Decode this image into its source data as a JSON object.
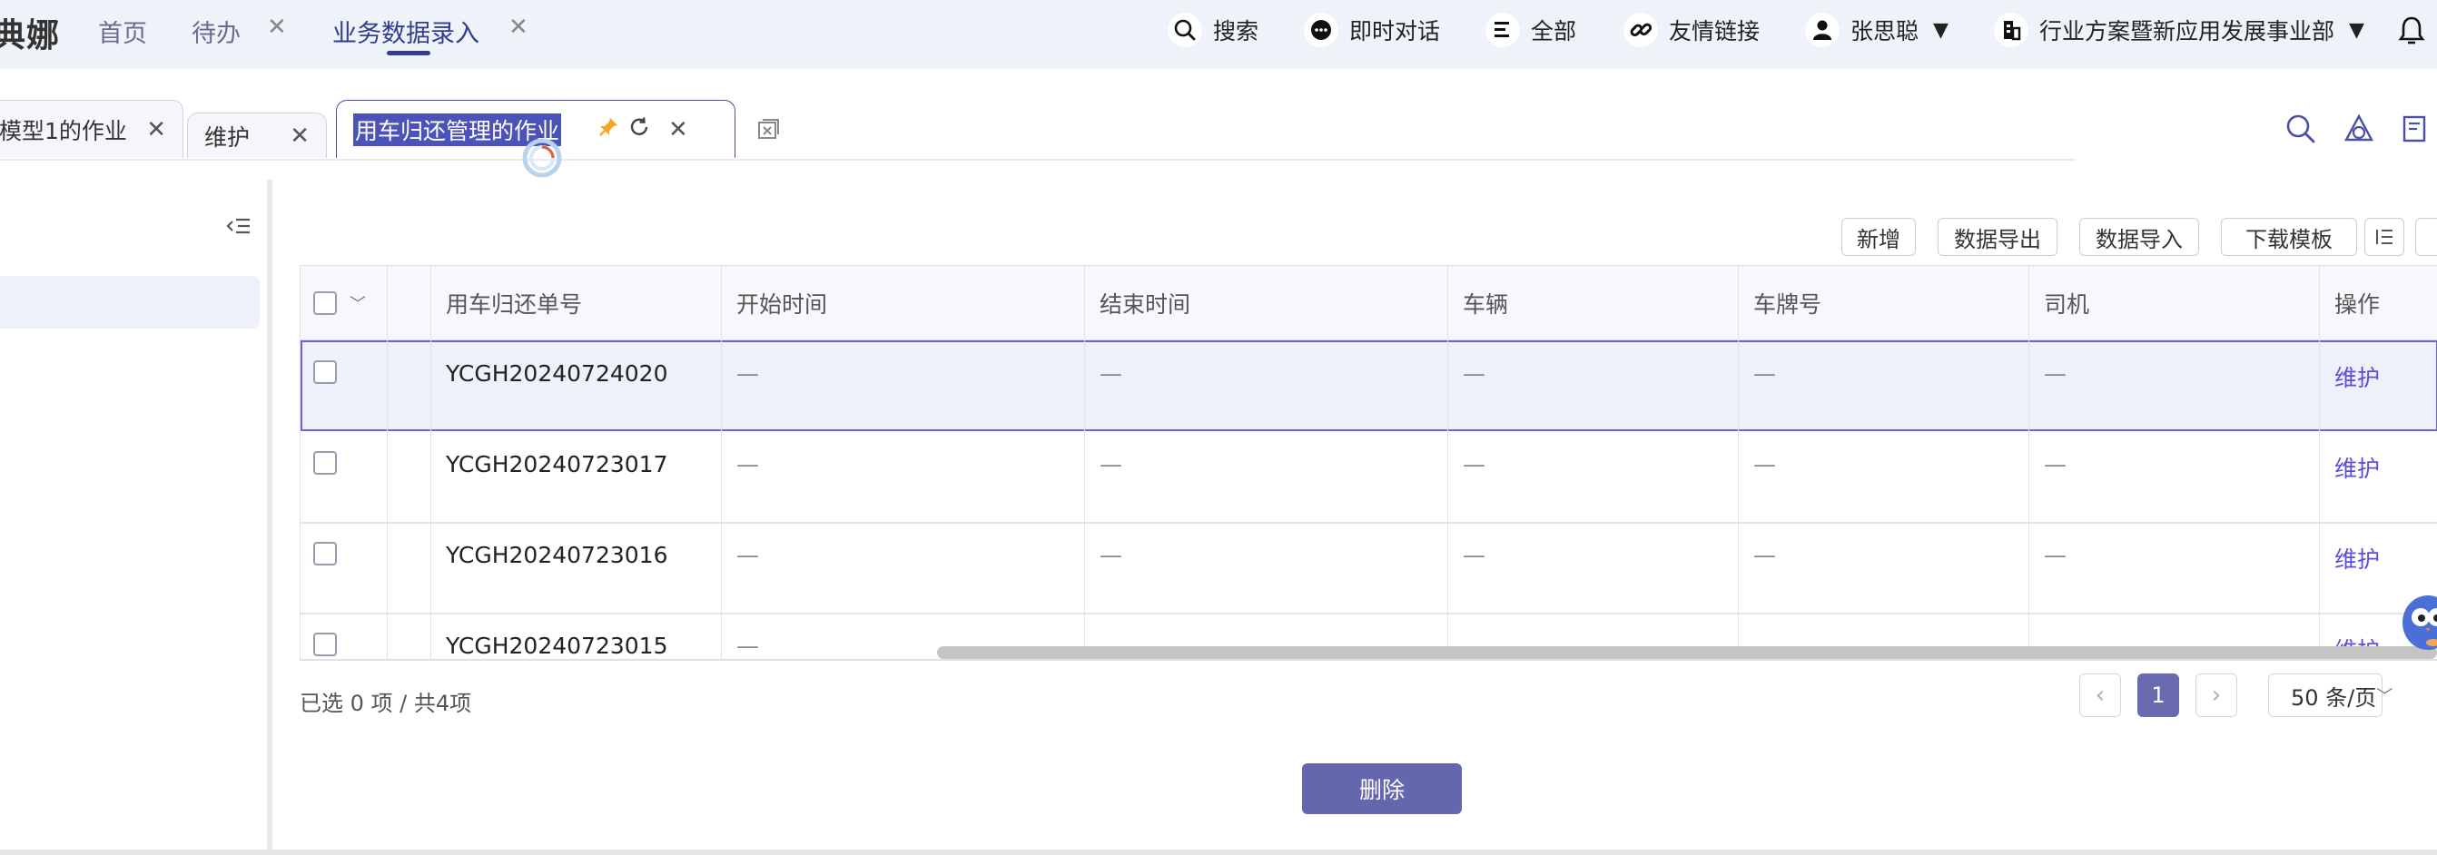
{
  "topbar": {
    "brand": "典娜",
    "nav": [
      {
        "label": "首页"
      },
      {
        "label": "待办"
      },
      {
        "label": "业务数据录入"
      }
    ],
    "tools": {
      "search": "搜索",
      "chat": "即时对话",
      "all": "全部",
      "links": "友情链接",
      "user": "张思聪",
      "org": "行业方案暨新应用发展事业部"
    }
  },
  "tabs": [
    {
      "label": "模型1的作业"
    },
    {
      "label": "维护"
    },
    {
      "label": "用车归还管理的作业"
    }
  ],
  "toolbar": {
    "add": "新增",
    "export": "数据导出",
    "import": "数据导入",
    "template": "下载模板"
  },
  "table": {
    "headers": [
      "用车归还单号",
      "开始时间",
      "结束时间",
      "车辆",
      "车牌号",
      "司机",
      "操作"
    ],
    "rows": [
      {
        "id": "YCGH20240724020",
        "start": "—",
        "end": "—",
        "vehicle": "—",
        "plate": "—",
        "driver": "—",
        "action": "维护"
      },
      {
        "id": "YCGH20240723017",
        "start": "—",
        "end": "—",
        "vehicle": "—",
        "plate": "—",
        "driver": "—",
        "action": "维护"
      },
      {
        "id": "YCGH20240723016",
        "start": "—",
        "end": "—",
        "vehicle": "—",
        "plate": "—",
        "driver": "—",
        "action": "维护"
      },
      {
        "id": "YCGH20240723015",
        "start": "—",
        "end": "—",
        "vehicle": "—",
        "plate": "—",
        "driver": "—",
        "action": "维护"
      }
    ]
  },
  "footer": {
    "summary": "已选 0 项 / 共4项",
    "current_page": "1",
    "page_size": "50 条/页",
    "delete": "删除"
  },
  "colors": {
    "accent": "#333d8f",
    "selection": "#6b63d6",
    "link": "#5b4fd8",
    "button": "#6466ae"
  }
}
